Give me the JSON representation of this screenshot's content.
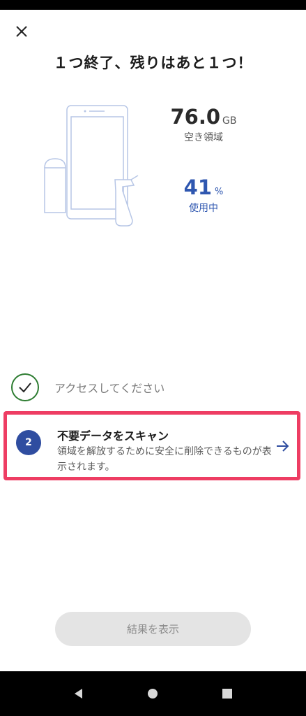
{
  "header": {
    "title": "１つ終了、残りはあと１つ！"
  },
  "storage": {
    "free_value": "76.0",
    "free_unit": "GB",
    "free_caption": "空き領域",
    "used_value": "41",
    "used_unit": "%",
    "used_caption": "使用中",
    "used_percent": 41
  },
  "steps": [
    {
      "status": "complete",
      "label": "アクセスしてください"
    },
    {
      "number": "2",
      "title": "不要データをスキャン",
      "description": "領域を解放するために安全に削除できるものが表示されます。"
    }
  ],
  "actions": {
    "results_button": "結果を表示"
  },
  "colors": {
    "accent_blue": "#2f57b0",
    "step_badge": "#2f4da0",
    "check_green": "#2e7d32",
    "highlight_border": "#ee3d63",
    "illustration_stroke": "#b7c6e6"
  },
  "icons": {
    "close": "close-icon",
    "check": "checkmark-icon",
    "arrow": "arrow-right-icon",
    "nav_back": "nav-back-icon",
    "nav_home": "nav-home-icon",
    "nav_recents": "nav-recents-icon"
  }
}
